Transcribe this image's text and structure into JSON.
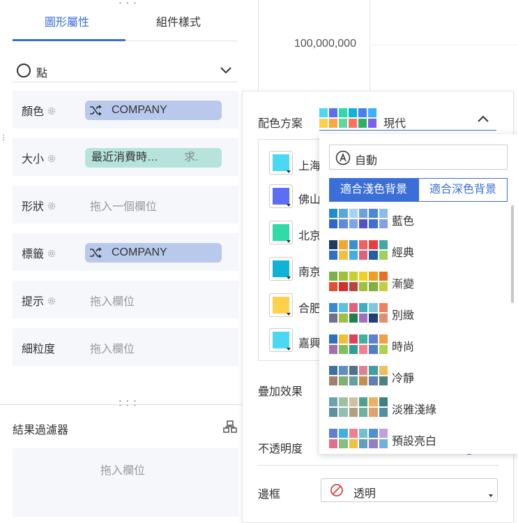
{
  "tabs": [
    {
      "label": "圖形屬性",
      "active": true
    },
    {
      "label": "組件樣式",
      "active": false
    }
  ],
  "mark_type": {
    "label": "點"
  },
  "encodings": [
    {
      "label": "顏色",
      "value": "COMPANY",
      "kind": "field"
    },
    {
      "label": "大小",
      "value": "最近消費時…",
      "suffix": "求.",
      "kind": "measure"
    },
    {
      "label": "形狀",
      "placeholder": "拖入一個欄位"
    },
    {
      "label": "標籤",
      "value": "COMPANY",
      "kind": "field"
    },
    {
      "label": "提示",
      "placeholder": "拖入欄位"
    },
    {
      "label": "細粒度",
      "placeholder": "拖入欄位"
    }
  ],
  "filter": {
    "title": "結果過濾器",
    "placeholder": "拖入欄位"
  },
  "axis": {
    "tick": "100,000,000"
  },
  "color_panel": {
    "scheme_label": "配色方案",
    "scheme_value": "現代",
    "items": [
      {
        "label": "上海",
        "color": "#4ad8f5"
      },
      {
        "label": "佛山",
        "color": "#5b6ef5"
      },
      {
        "label": "北京",
        "color": "#2fdba6"
      },
      {
        "label": "南京",
        "color": "#10b3d8"
      },
      {
        "label": "合肥",
        "color": "#ffd04a"
      },
      {
        "label": "嘉興",
        "color": "#4ad8f5"
      }
    ],
    "overlay_label": "疊加效果",
    "opacity_label": "不透明度",
    "border_label": "邊框",
    "border_value": "透明"
  },
  "dropdown": {
    "auto_label": "自動",
    "tabs": [
      "適合淺色背景",
      "適合深色背景"
    ],
    "schemes": [
      {
        "label": "藍色",
        "colors": [
          "#1f8ecf",
          "#5aa7e0",
          "#a8d2ef",
          "#6aa3dd",
          "#4f86d6",
          "#8cbdea",
          "#2f66c8",
          "#5f8ae0",
          "#7da3ea",
          "#5550d0",
          "#3f6fd6",
          "#82a0e8"
        ]
      },
      {
        "label": "經典",
        "colors": [
          "#1f3a5f",
          "#f0a830",
          "#3a8fd0",
          "#f06060",
          "#e84040",
          "#40a8a0",
          "#3070c0",
          "#f0c040",
          "#40b0e0",
          "#e06080",
          "#2060a0",
          "#a0d060"
        ]
      },
      {
        "label": "漸變",
        "colors": [
          "#7bb04a",
          "#a0c040",
          "#c8d030",
          "#f0d020",
          "#f0a020",
          "#e87020",
          "#e05030",
          "#d03030",
          "#c04040",
          "#a0c040",
          "#80b040",
          "#c0d040"
        ]
      },
      {
        "label": "別緻",
        "colors": [
          "#3c88d8",
          "#60c0e0",
          "#e06080",
          "#40b0c0",
          "#80c8e0",
          "#f08060",
          "#707090",
          "#a0c040",
          "#208050",
          "#a070c0",
          "#204070",
          "#e09070"
        ]
      },
      {
        "label": "時尚",
        "colors": [
          "#3070c0",
          "#f0c030",
          "#e04060",
          "#40b0a0",
          "#6080d0",
          "#f0a040",
          "#a070b0",
          "#80c060",
          "#30a090",
          "#f08090",
          "#5080c0",
          "#b0d050"
        ]
      },
      {
        "label": "冷靜",
        "colors": [
          "#4070a0",
          "#6090c0",
          "#507090",
          "#e08090",
          "#40a0a0",
          "#f0c060",
          "#a08070",
          "#80b070",
          "#60a0a0",
          "#c09050",
          "#6080b0",
          "#508080"
        ]
      },
      {
        "label": "淡雅淺綠",
        "colors": [
          "#70a0b0",
          "#a0c0a0",
          "#d0c0a0",
          "#50a090",
          "#f0b060",
          "#408080",
          "#6090a0",
          "#90c0b0",
          "#b0a080",
          "#70b0a0",
          "#e0a070",
          "#5090a0"
        ]
      },
      {
        "label": "預設亮白",
        "colors": [
          "#6080d0",
          "#40b0e0",
          "#f08090",
          "#70c0d0",
          "#5090d0",
          "#c0a0e0",
          "#e07090",
          "#80c080",
          "#f0c040",
          "#60a0c0",
          "#9080c0",
          "#70b0e0"
        ]
      }
    ]
  },
  "modern_palette": [
    "#4ad8f5",
    "#5b6ef5",
    "#2fdba6",
    "#10b3d8",
    "#4a7ef5",
    "#3ab0ff",
    "#ffd04a",
    "#ffa640",
    "#5fd8a0",
    "#ff7060",
    "#30b060",
    "#7a60f0"
  ]
}
